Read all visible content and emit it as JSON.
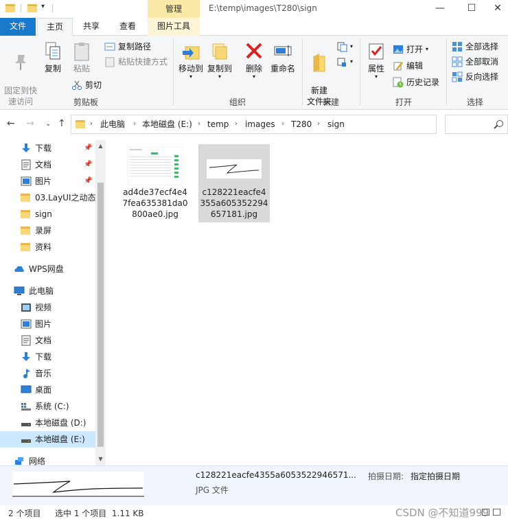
{
  "window": {
    "title": "E:\\temp\\images\\T280\\sign",
    "contextual_tab_group": "管理",
    "minimize_glyph": "—",
    "maximize_glyph": "☐",
    "close_glyph": "✕"
  },
  "tabs": [
    {
      "label": "文件"
    },
    {
      "label": "主页"
    },
    {
      "label": "共享"
    },
    {
      "label": "查看"
    },
    {
      "label": "图片工具"
    }
  ],
  "ribbon": {
    "clipboard": {
      "label": "剪贴板",
      "pin_quick_access": "固定到快\n速访问",
      "copy": "复制",
      "paste": "粘贴",
      "copy_path": "复制路径",
      "paste_shortcut": "粘贴快捷方式",
      "cut": "剪切"
    },
    "organize": {
      "label": "组织",
      "move_to": "移动到",
      "copy_to": "复制到",
      "delete": "删除",
      "rename": "重命名"
    },
    "new": {
      "label": "新建",
      "new_folder": "新建\n文件夹"
    },
    "open": {
      "label": "打开",
      "properties": "属性",
      "open": "打开",
      "edit": "编辑",
      "history": "历史记录"
    },
    "select": {
      "label": "选择",
      "select_all": "全部选择",
      "select_none": "全部取消",
      "invert": "反向选择"
    }
  },
  "address": {
    "crumbs": [
      "此电脑",
      "本地磁盘 (E:)",
      "temp",
      "images",
      "T280",
      "sign"
    ],
    "search_placeholder": ""
  },
  "sidebar": {
    "quick_access": [
      {
        "label": "下载",
        "icon": "download-arrow-icon",
        "pinned": true
      },
      {
        "label": "文档",
        "icon": "document-icon",
        "pinned": true
      },
      {
        "label": "图片",
        "icon": "picture-icon",
        "pinned": true
      },
      {
        "label": "03.LayUI之动态",
        "icon": "folder-icon",
        "pinned": false
      },
      {
        "label": "sign",
        "icon": "folder-icon",
        "pinned": false
      },
      {
        "label": "录屏",
        "icon": "folder-icon",
        "pinned": false
      },
      {
        "label": "资料",
        "icon": "folder-icon",
        "pinned": false
      }
    ],
    "wps": {
      "label": "WPS网盘",
      "icon": "cloud-icon"
    },
    "this_pc": {
      "label": "此电脑",
      "icon": "computer-icon"
    },
    "pc_items": [
      {
        "label": "视频",
        "icon": "video-icon"
      },
      {
        "label": "图片",
        "icon": "picture-icon"
      },
      {
        "label": "文档",
        "icon": "document-icon"
      },
      {
        "label": "下载",
        "icon": "download-arrow-icon"
      },
      {
        "label": "音乐",
        "icon": "music-note-icon"
      },
      {
        "label": "桌面",
        "icon": "desktop-icon"
      },
      {
        "label": "系统 (C:)",
        "icon": "windows-drive-icon"
      },
      {
        "label": "本地磁盘 (D:)",
        "icon": "drive-icon"
      },
      {
        "label": "本地磁盘 (E:)",
        "icon": "drive-icon",
        "selected": true
      }
    ],
    "network": {
      "label": "网络",
      "icon": "network-icon"
    }
  },
  "files": [
    {
      "name": "ad4de37ecf4e47fea635381da0800ae0.jpg",
      "thumb": "screenshot-thumbnail",
      "selected": false
    },
    {
      "name": "c128221eacfe4355a605352294657181.jpg",
      "thumb": "signature-thumbnail",
      "selected": true
    }
  ],
  "details": {
    "name": "c128221eacfe4355a6053522946571...",
    "date_key": "拍摄日期:",
    "date_value": "指定拍摄日期",
    "type": "JPG 文件"
  },
  "status": {
    "count": "2 个项目",
    "selection": "选中 1 个项目  1.11 KB",
    "watermark": "CSDN @不知道999"
  },
  "colors": {
    "file_tab": "#1979ca",
    "manage_tab": "#fbe9a7",
    "folder": "#f8d775",
    "selection": "#cce8ff",
    "selected_file": "#d9d9d9",
    "delete_red": "#e02020"
  }
}
